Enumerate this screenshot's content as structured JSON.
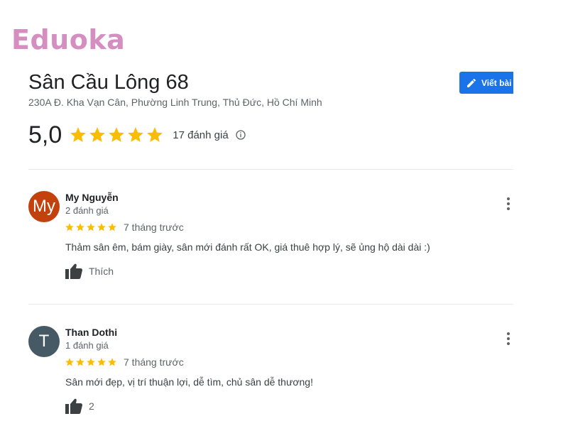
{
  "watermark": {
    "logo_text": "Eduoka"
  },
  "place": {
    "name": "Sân Cầu Lông 68",
    "address": "230A Đ. Kha Vạn Cân, Phường Linh Trung, Thủ Đức, Hồ Chí Minh",
    "rating": "5,0",
    "rating_value": 5,
    "review_count_label": "17 đánh giá"
  },
  "write_review_button": {
    "label": "Viết bài"
  },
  "colors": {
    "star": "#fbbc04",
    "accent": "#1a73e8",
    "logo": "#d48ec0"
  },
  "icons": {
    "star": "star-icon",
    "info": "info-icon",
    "pencil": "pencil-icon",
    "thumb": "thumbs-up-icon",
    "more": "more-vert-icon"
  },
  "reviews": [
    {
      "avatar_initials": "My",
      "avatar_color": "#c2410c",
      "name": "My Nguyễn",
      "count": "2 đánh giá",
      "rating_value": 5,
      "time": "7 tháng trước",
      "text": "Thảm sân êm, bám giày, sân mới đánh rất OK, giá thuê hợp lý, sẽ ủng hộ dài dài :)",
      "like_label": "Thích"
    },
    {
      "avatar_initials": "T",
      "avatar_color": "#455a64",
      "name": "Than Dothi",
      "count": "1 đánh giá",
      "rating_value": 5,
      "time": "7 tháng trước",
      "text": "Sân mới đẹp, vị trí thuận lợi, dễ tìm, chủ sân dễ thương!",
      "like_label": "2"
    }
  ]
}
